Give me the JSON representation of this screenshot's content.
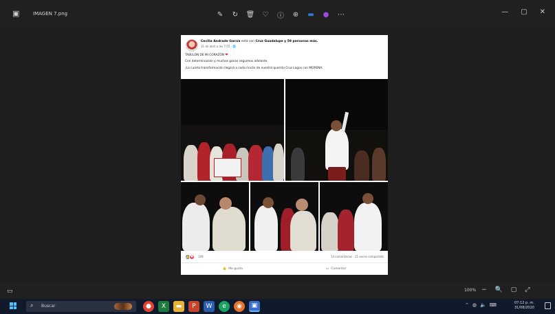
{
  "window": {
    "title": "IMAGEN 7.png",
    "tools": [
      "edit-icon",
      "rotate-icon",
      "delete-icon",
      "favorite-icon",
      "info-icon",
      "share-icon",
      "folder-icon",
      "app-icon",
      "more-icon"
    ],
    "controls": [
      "minimize-icon",
      "maximize-icon",
      "close-icon"
    ]
  },
  "post": {
    "author": "Cecilia Andrade García",
    "with_text": "está con",
    "tagged": "Cruz Guadalupe y 59 personas más.",
    "meta": "31 de abril a las 7:55 · 🌐",
    "lines": [
      "TABULÓN DE MI CORAZÓN",
      "Con determinación y muchas ganas seguimos adelante.",
      "¡La cuarta transformación llegará a cada rincón de nuestra querida Cruz Lagos con MORENA."
    ],
    "reactions_count": "109",
    "reactions_right": "14 comentarios · 21 veces compartido",
    "actions": [
      {
        "icon": "like-icon",
        "label": "Me gusta"
      },
      {
        "icon": "comment-icon",
        "label": "Comentar"
      }
    ]
  },
  "viewer": {
    "zoom": "100%"
  },
  "taskbar": {
    "search_placeholder": "Buscar",
    "clock_time": "07:12 p. m.",
    "clock_date": "31/08/2020"
  }
}
